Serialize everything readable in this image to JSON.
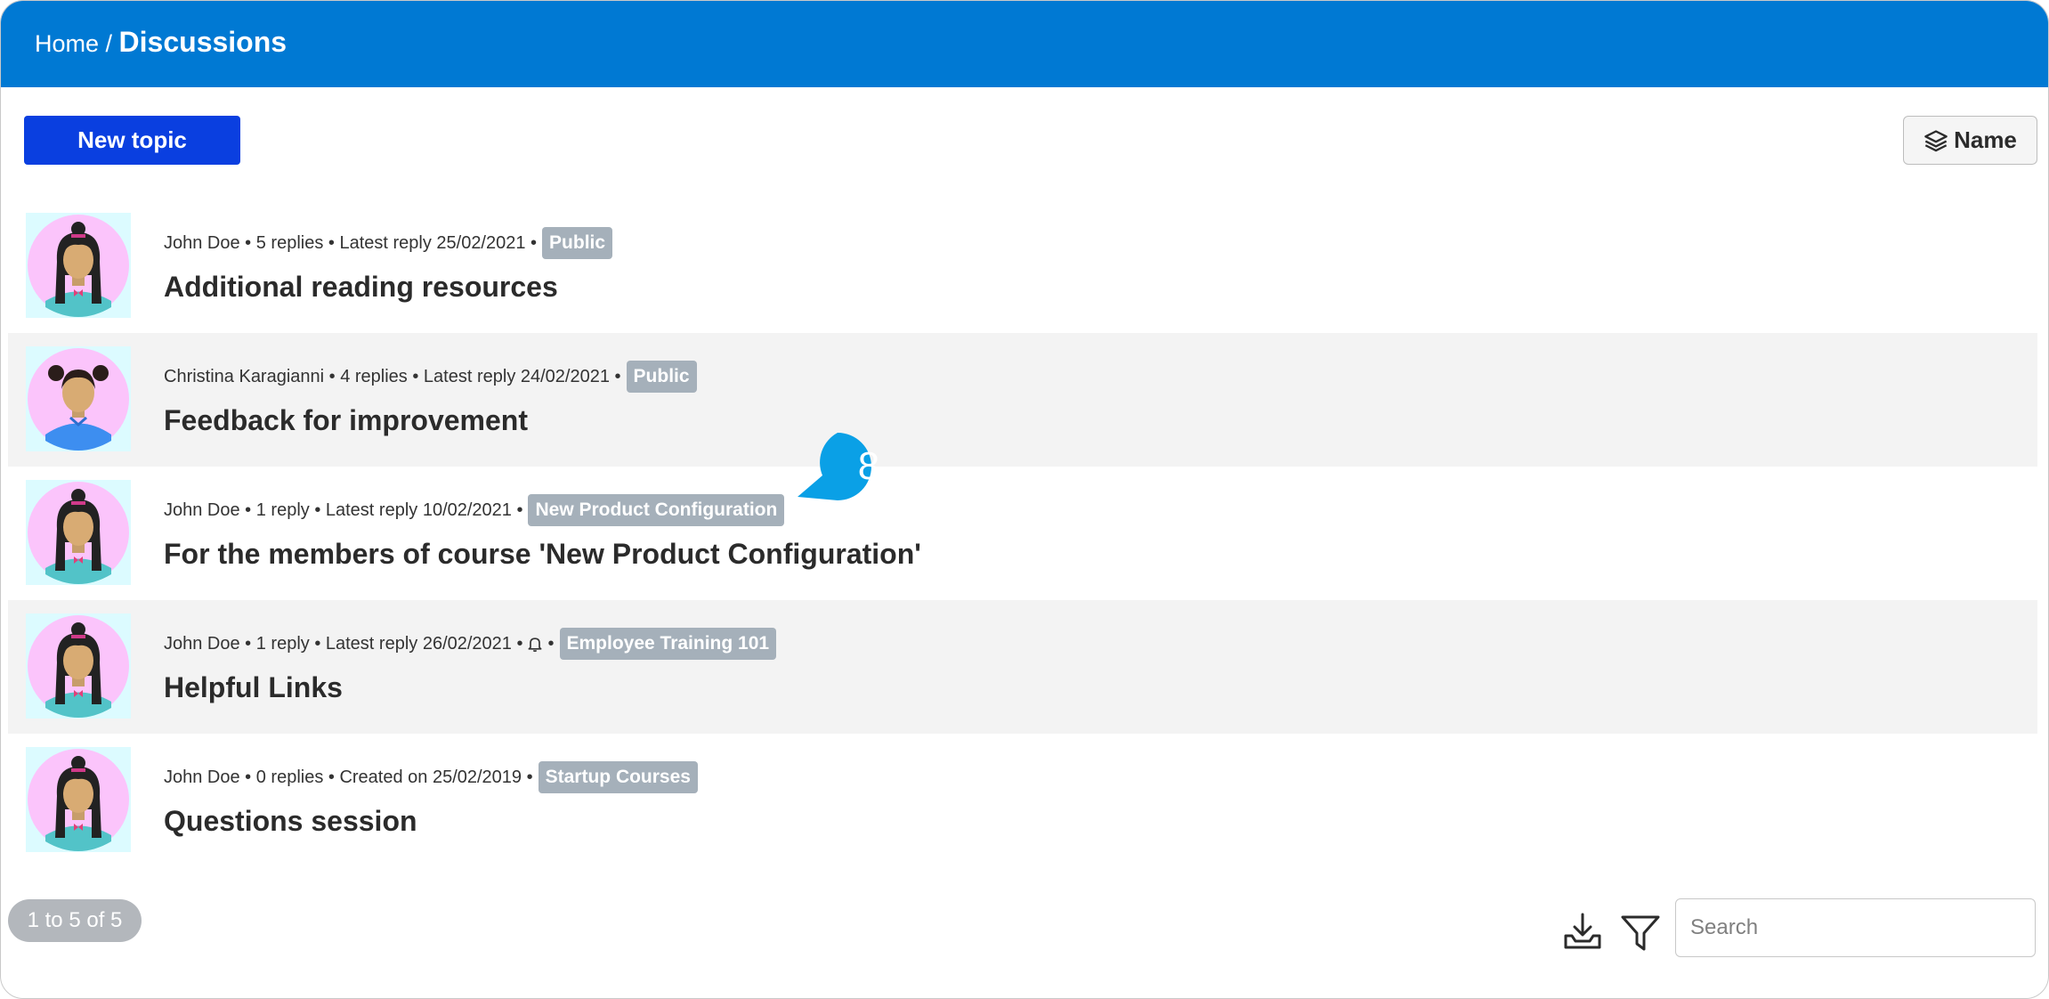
{
  "breadcrumb": {
    "home": "Home /",
    "current": "Discussions"
  },
  "toolbar": {
    "new_topic_label": "New topic",
    "sort_label": "Name"
  },
  "topics": [
    {
      "meta": "John Doe • 5 replies • Latest reply 25/02/2021 •",
      "badge": "Public",
      "title": "Additional reading resources",
      "avatar": "girl-bun-pink-top"
    },
    {
      "meta": "Christina Karagianni • 4 replies • Latest reply 24/02/2021 •",
      "badge": "Public",
      "title": "Feedback for improvement",
      "avatar": "girl-pigtails-blue-shirt"
    },
    {
      "meta": "John Doe • 1 reply • Latest reply 10/02/2021 •",
      "badge": "New Product Configuration",
      "title": "For the members of course 'New Product Configuration'",
      "avatar": "girl-bun-pink-top"
    },
    {
      "meta_before": "John Doe • 1 reply • Latest reply 26/02/2021 •",
      "meta_after": "•",
      "badge": "Employee Training 101",
      "title": "Helpful Links",
      "avatar": "girl-bun-pink-top",
      "icon": "bell-icon"
    },
    {
      "meta": "John Doe • 0 replies • Created on 25/02/2019 •",
      "badge": "Startup Courses",
      "title": "Questions session",
      "avatar": "girl-bun-pink-top"
    }
  ],
  "callout": {
    "number": "8",
    "color": "#0aa0e6"
  },
  "footer": {
    "pagination": "1 to 5 of 5",
    "search_placeholder": "Search",
    "export_icon": "download-tray-icon",
    "filter_icon": "filter-icon"
  },
  "colors": {
    "header": "#0079d3",
    "primary_button": "#0a3fe0",
    "badge": "#a5b0ba"
  }
}
